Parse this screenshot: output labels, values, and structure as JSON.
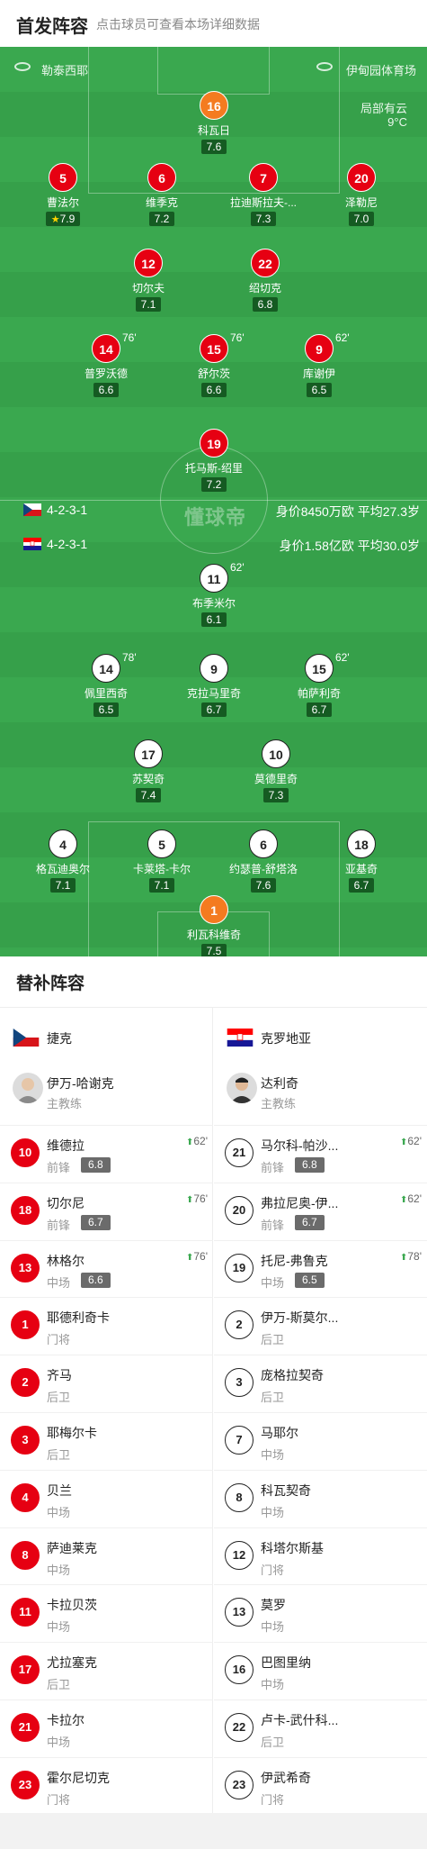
{
  "header": {
    "title": "首发阵容",
    "hint": "点击球员可查看本场详细数据"
  },
  "pitch": {
    "referee": "勒泰西耶",
    "venue": "伊甸园体育场",
    "weather": "局部有云",
    "temperature": "9°C",
    "watermark": "懂球帝",
    "home": {
      "flag": "czech-flag",
      "formation": "4-2-3-1",
      "value": "身价8450万欧  平均27.3岁"
    },
    "away": {
      "flag": "croatia-flag",
      "formation": "4-2-3-1",
      "value": "身价1.58亿欧  平均30.0岁"
    }
  },
  "home_players": [
    {
      "num": "16",
      "name": "科瓦日",
      "rating": "7.6",
      "kind": "orange"
    },
    {
      "num": "5",
      "name": "曹法尔",
      "rating": "7.9",
      "kind": "red",
      "star": "★"
    },
    {
      "num": "6",
      "name": "维季克",
      "rating": "7.2",
      "kind": "red"
    },
    {
      "num": "7",
      "name": "拉迪斯拉夫-...",
      "rating": "7.3",
      "kind": "red"
    },
    {
      "num": "20",
      "name": "泽勒尼",
      "rating": "7.0",
      "kind": "red"
    },
    {
      "num": "12",
      "name": "切尔夫",
      "rating": "7.1",
      "kind": "red"
    },
    {
      "num": "22",
      "name": "绍切克",
      "rating": "6.8",
      "kind": "red",
      "cap": "C"
    },
    {
      "num": "14",
      "name": "普罗沃德",
      "rating": "6.6",
      "kind": "red",
      "sub": "76'"
    },
    {
      "num": "15",
      "name": "舒尔茨",
      "rating": "6.6",
      "kind": "red",
      "sub": "76'"
    },
    {
      "num": "9",
      "name": "库谢伊",
      "rating": "6.5",
      "kind": "red",
      "sub": "62'"
    },
    {
      "num": "19",
      "name": "托马斯-绍里",
      "rating": "7.2",
      "kind": "red"
    }
  ],
  "away_players": [
    {
      "num": "11",
      "name": "布季米尔",
      "rating": "6.1",
      "kind": "white",
      "sub": "62'"
    },
    {
      "num": "14",
      "name": "佩里西奇",
      "rating": "6.5",
      "kind": "white",
      "sub": "78'"
    },
    {
      "num": "9",
      "name": "克拉马里奇",
      "rating": "6.7",
      "kind": "white",
      "yc": "1"
    },
    {
      "num": "15",
      "name": "帕萨利奇",
      "rating": "6.7",
      "kind": "white",
      "sub": "62'"
    },
    {
      "num": "17",
      "name": "苏契奇",
      "rating": "7.4",
      "kind": "white",
      "yc": "1"
    },
    {
      "num": "10",
      "name": "莫德里奇",
      "rating": "7.3",
      "kind": "white",
      "cap": "C"
    },
    {
      "num": "4",
      "name": "格瓦迪奥尔",
      "rating": "7.1",
      "kind": "white"
    },
    {
      "num": "5",
      "name": "卡莱塔-卡尔",
      "rating": "7.1",
      "kind": "white"
    },
    {
      "num": "6",
      "name": "约瑟普-舒塔洛",
      "rating": "7.6",
      "kind": "white"
    },
    {
      "num": "18",
      "name": "亚基奇",
      "rating": "6.7",
      "kind": "white"
    },
    {
      "num": "1",
      "name": "利瓦科维奇",
      "rating": "7.5",
      "kind": "orange"
    }
  ],
  "bench": {
    "title": "替补阵容",
    "home": {
      "team": "捷克",
      "coach": {
        "name": "伊万-哈谢克",
        "role": "主教练"
      },
      "players": [
        {
          "num": "10",
          "name": "维德拉",
          "pos": "前锋",
          "rating": "6.8",
          "on": "62'"
        },
        {
          "num": "18",
          "name": "切尔尼",
          "pos": "前锋",
          "rating": "6.7",
          "on": "76'"
        },
        {
          "num": "13",
          "name": "林格尔",
          "pos": "中场",
          "rating": "6.6",
          "on": "76'"
        },
        {
          "num": "1",
          "name": "耶德利奇卡",
          "pos": "门将"
        },
        {
          "num": "2",
          "name": "齐马",
          "pos": "后卫"
        },
        {
          "num": "3",
          "name": "耶梅尔卡",
          "pos": "后卫"
        },
        {
          "num": "4",
          "name": "贝兰",
          "pos": "中场"
        },
        {
          "num": "8",
          "name": "萨迪莱克",
          "pos": "中场"
        },
        {
          "num": "11",
          "name": "卡拉贝茨",
          "pos": "中场"
        },
        {
          "num": "17",
          "name": "尤拉塞克",
          "pos": "后卫"
        },
        {
          "num": "21",
          "name": "卡拉尔",
          "pos": "中场"
        },
        {
          "num": "23",
          "name": "霍尔尼切克",
          "pos": "门将"
        }
      ]
    },
    "away": {
      "team": "克罗地亚",
      "coach": {
        "name": "达利奇",
        "role": "主教练"
      },
      "players": [
        {
          "num": "21",
          "name": "马尔科-帕沙...",
          "pos": "前锋",
          "rating": "6.8",
          "on": "62'"
        },
        {
          "num": "20",
          "name": "弗拉尼奥-伊...",
          "pos": "前锋",
          "rating": "6.7",
          "on": "62'"
        },
        {
          "num": "19",
          "name": "托尼-弗鲁克",
          "pos": "中场",
          "rating": "6.5",
          "on": "78'"
        },
        {
          "num": "2",
          "name": "伊万-斯莫尔...",
          "pos": "后卫"
        },
        {
          "num": "3",
          "name": "庞格拉契奇",
          "pos": "后卫"
        },
        {
          "num": "7",
          "name": "马耶尔",
          "pos": "中场"
        },
        {
          "num": "8",
          "name": "科瓦契奇",
          "pos": "中场"
        },
        {
          "num": "12",
          "name": "科塔尔斯基",
          "pos": "门将"
        },
        {
          "num": "13",
          "name": "莫罗",
          "pos": "中场"
        },
        {
          "num": "16",
          "name": "巴图里纳",
          "pos": "中场"
        },
        {
          "num": "22",
          "name": "卢卡-武什科...",
          "pos": "后卫"
        },
        {
          "num": "23",
          "name": "伊武希奇",
          "pos": "门将"
        }
      ]
    }
  }
}
